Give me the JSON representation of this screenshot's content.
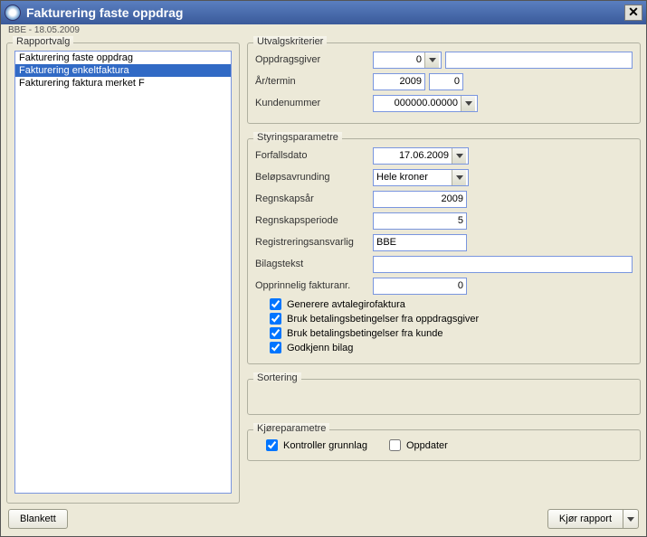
{
  "window": {
    "title": "Fakturering faste oppdrag",
    "subtitle": "BBE - 18.05.2009"
  },
  "leftPanel": {
    "title": "Rapportvalg",
    "items": [
      {
        "label": "Fakturering faste oppdrag",
        "selected": false
      },
      {
        "label": "Fakturering enkeltfaktura",
        "selected": true
      },
      {
        "label": "Fakturering faktura merket F",
        "selected": false
      }
    ]
  },
  "utvalg": {
    "title": "Utvalgskriterier",
    "oppdragsgiverLabel": "Oppdragsgiver",
    "oppdragsgiverValue": "0",
    "oppdragsgiverExtra": "",
    "aarTerminLabel": "År/termin",
    "aarValue": "2009",
    "terminValue": "0",
    "kundenummerLabel": "Kundenummer",
    "kundenummerValue": "000000.00000"
  },
  "styring": {
    "title": "Styringsparametre",
    "forfallLabel": "Forfallsdato",
    "forfallValue": "17.06.2009",
    "belopLabel": "Beløpsavrunding",
    "belopValue": "Hele kroner",
    "regnAarLabel": "Regnskapsår",
    "regnAarValue": "2009",
    "regnPeriodeLabel": "Regnskapsperiode",
    "regnPeriodeValue": "5",
    "regAnsLabel": "Registreringsansvarlig",
    "regAnsValue": "BBE",
    "bilagLabel": "Bilagstekst",
    "bilagValue": "",
    "oppFakLabel": "Opprinnelig fakturanr.",
    "oppFakValue": "0",
    "cb1": "Generere avtalegirofaktura",
    "cb2": "Bruk betalingsbetingelser fra oppdragsgiver",
    "cb3": "Bruk betalingsbetingelser fra kunde",
    "cb4": "Godkjenn bilag"
  },
  "sortering": {
    "title": "Sortering"
  },
  "kjore": {
    "title": "Kjøreparametre",
    "kontroller": "Kontroller grunnlag",
    "oppdater": "Oppdater"
  },
  "footer": {
    "blankett": "Blankett",
    "kjorRapport": "Kjør rapport"
  }
}
